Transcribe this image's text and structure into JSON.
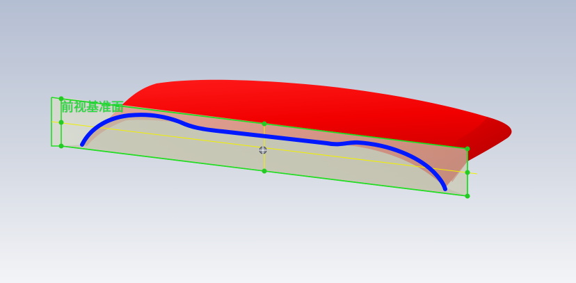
{
  "viewport": {
    "background_top": "#b6c0d4",
    "background_bottom": "#f2f3f6"
  },
  "part": {
    "body_color": "#ff0000",
    "body_shade": "#b80000",
    "sketch_color": "#0018ff"
  },
  "reference_plane": {
    "label": "前视基准面",
    "label_color": "#22e53a",
    "border_color": "#22dd22",
    "fill_color": "#d8dccd"
  }
}
